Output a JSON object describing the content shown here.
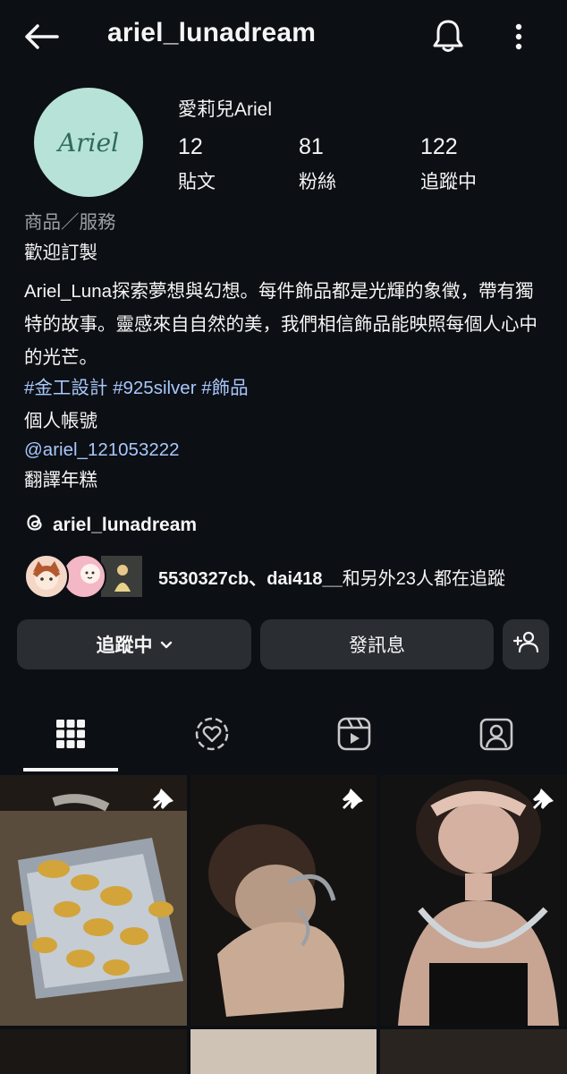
{
  "header": {
    "username": "ariel_lunadream",
    "back_icon": "back-arrow-icon",
    "bell_icon": "bell-icon",
    "more_icon": "more-vertical-icon"
  },
  "profile": {
    "avatar_text": "Ariel",
    "display_name": "愛莉兒Ariel",
    "stats": [
      {
        "value": "12",
        "label": "貼文"
      },
      {
        "value": "81",
        "label": "粉絲"
      },
      {
        "value": "122",
        "label": "追蹤中"
      }
    ]
  },
  "bio": {
    "category": "商品／服務",
    "line1": "歡迎訂製",
    "description": "Ariel_Luna探索夢想與幻想。每件飾品都是光輝的象徵，帶有獨特的故事。靈感來自自然的美，我們相信飾品能映照每個人心中的光芒。",
    "hashtags": "#金工設計 #925silver #飾品",
    "personal_label": "個人帳號",
    "mention": "@ariel_121053222",
    "translate": "翻譯年糕"
  },
  "threads": {
    "handle": "ariel_lunadream",
    "icon": "threads-icon"
  },
  "followed_by": {
    "names": "5530327cb、dai418__",
    "suffix": "和另外23人都在追蹤"
  },
  "buttons": {
    "following": "追蹤中",
    "message": "發訊息",
    "add_person_icon": "add-person-icon"
  },
  "tabs": [
    "grid-icon",
    "reels-heart-icon",
    "reels-icon",
    "tagged-icon"
  ],
  "colors": {
    "background": "#0c0f14",
    "button": "#2a2d32",
    "link": "#a8c7fa",
    "avatar": "#b7e2d7"
  }
}
